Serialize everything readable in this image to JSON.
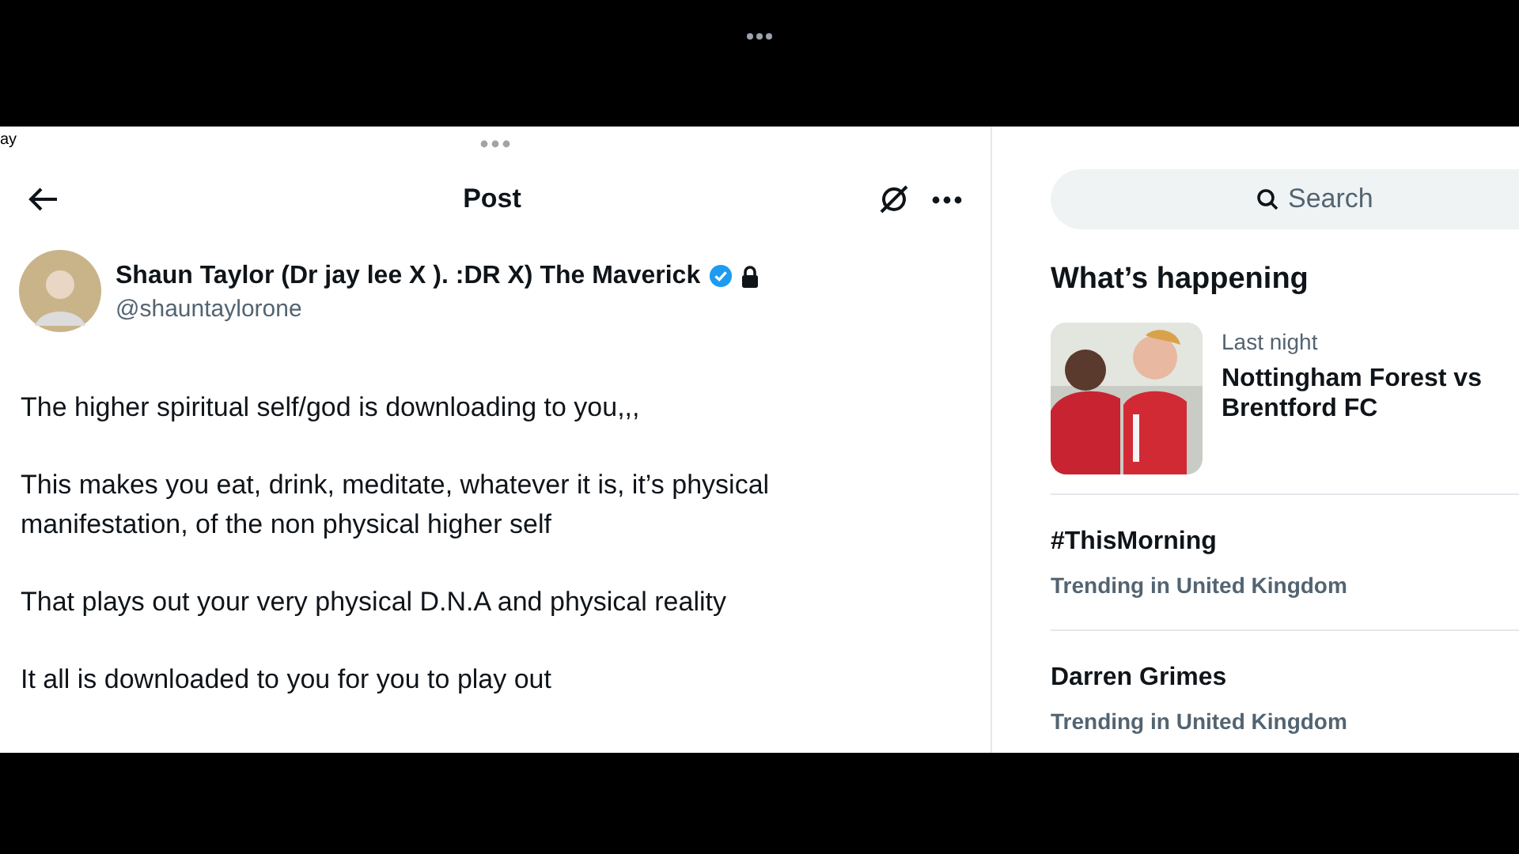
{
  "status_corner": {
    "text": "ay"
  },
  "header": {
    "title": "Post"
  },
  "author": {
    "name": "Shaun Taylor (Dr jay lee X ). :DR X) The Maverick",
    "verified": true,
    "protected": true,
    "handle": "@shauntaylorone"
  },
  "post": {
    "paragraphs": [
      "The higher spiritual self/god is downloading to you,,,",
      "This makes you eat, drink, meditate, whatever it is, it’s physical manifestation, of the non physical higher self",
      "That plays out your very physical D.N.A and physical reality",
      "It all is downloaded to you for you to play out"
    ]
  },
  "search": {
    "placeholder": "Search"
  },
  "trends": {
    "title": "What’s happening",
    "items": [
      {
        "kind": "picture",
        "context": "Last night",
        "topic": "Nottingham Forest vs Brentford FC"
      },
      {
        "kind": "text",
        "topic": "#ThisMorning",
        "context": "Trending in United Kingdom"
      },
      {
        "kind": "text",
        "topic": "Darren Grimes",
        "context": "Trending in United Kingdom"
      }
    ]
  }
}
